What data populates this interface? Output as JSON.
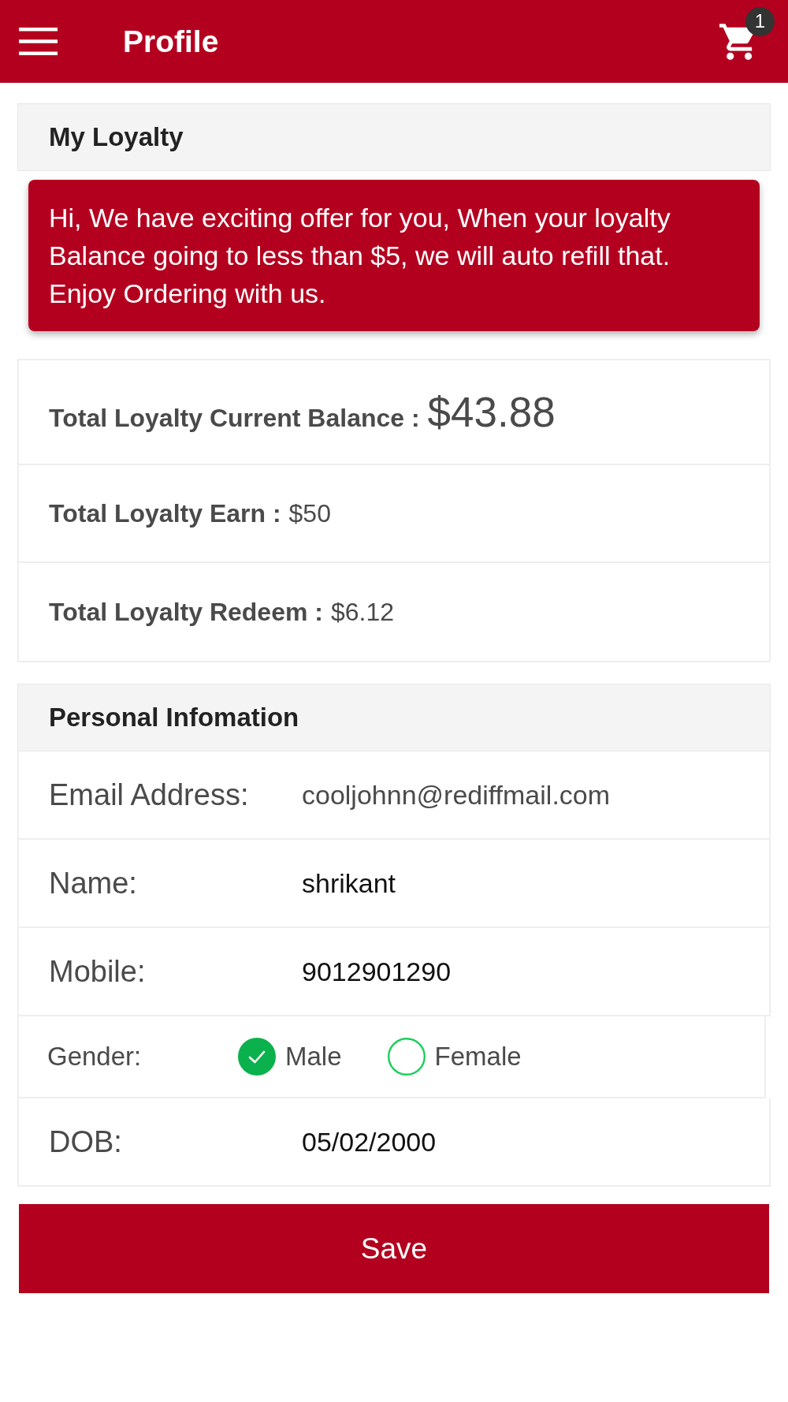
{
  "header": {
    "title": "Profile",
    "cart_badge": "1"
  },
  "loyalty": {
    "heading": "My Loyalty",
    "notice": "Hi, We have exciting offer for you, When your loyalty Balance going to less than $5, we will auto refill that. Enjoy Ordering with us.",
    "rows": [
      {
        "kind": "large",
        "label": "Total Loyalty Current Balance :",
        "value": "$43.88"
      },
      {
        "kind": "normal",
        "label": "Total Loyalty Earn :",
        "value": "$50"
      },
      {
        "kind": "normal",
        "label": "Total Loyalty Redeem :",
        "value": "$6.12"
      }
    ]
  },
  "personal": {
    "heading": "Personal Infomation",
    "fields": [
      {
        "kind": "text",
        "label": "Email Address:",
        "value": "cooljohnn@rediffmail.com",
        "disabled": true
      },
      {
        "kind": "text",
        "label": "Name:",
        "value": "shrikant",
        "disabled": false
      },
      {
        "kind": "text",
        "label": "Mobile:",
        "value": "9012901290",
        "disabled": false
      },
      {
        "kind": "radio",
        "label": "Gender:",
        "options": [
          {
            "label": "Male",
            "selected": true
          },
          {
            "label": "Female",
            "selected": false
          }
        ]
      },
      {
        "kind": "text",
        "label": "DOB:",
        "value": "05/02/2000",
        "disabled": false
      }
    ]
  },
  "save_button": "Save"
}
